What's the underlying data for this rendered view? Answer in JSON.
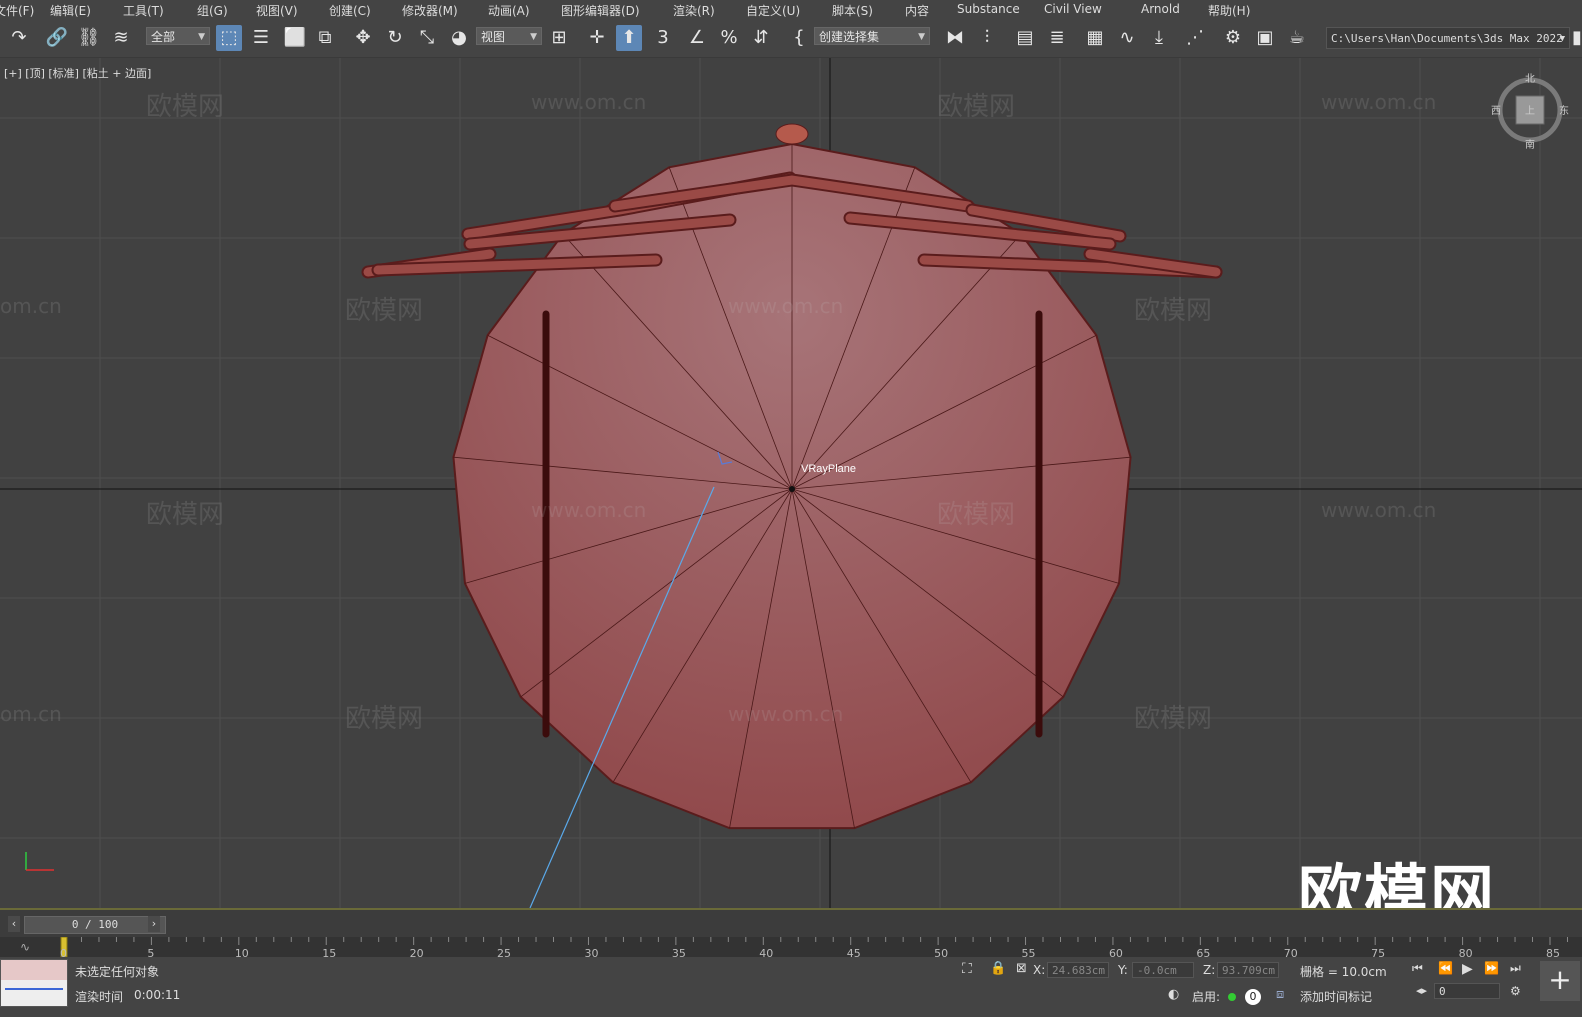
{
  "menu": [
    "文件(F)",
    "编辑(E)",
    "工具(T)",
    "组(G)",
    "视图(V)",
    "创建(C)",
    "修改器(M)",
    "动画(A)",
    "图形编辑器(D)",
    "渲染(R)",
    "自定义(U)",
    "脚本(S)",
    "内容",
    "Substance",
    "Civil View",
    "Arnold",
    "帮助(H)"
  ],
  "toolbar": {
    "selection_filter": "全部",
    "ref_coord": "视图",
    "named_selection": "创建选择集",
    "snap_label": "3",
    "project_path": "C:\\Users\\Han\\Documents\\3ds Max 2022"
  },
  "viewport": {
    "label": "[+] [顶] [标准] [粘土 + 边面]",
    "object_label": "VRayPlane",
    "viewcube": {
      "top": "北",
      "bottom": "南",
      "left": "西",
      "right": "东",
      "face": "上"
    },
    "watermark_text": "欧模网",
    "watermark_url": "www.om.cn",
    "watermark_url_partial": "om.cn",
    "big_watermark": "欧模网",
    "object_color": "#a85a5e"
  },
  "timeline": {
    "frame_display": "0 / 100",
    "ticks": [
      "0",
      "5",
      "10",
      "15",
      "20",
      "25",
      "30",
      "35",
      "40",
      "45",
      "50",
      "55",
      "60",
      "65",
      "70",
      "75",
      "80",
      "85"
    ]
  },
  "status": {
    "selection": "未选定任何对象",
    "render_time_label": "渲染时间",
    "render_time_value": "0:00:11",
    "x_label": "X:",
    "x_value": "24.683cm",
    "y_label": "Y:",
    "y_value": "-0.0cm",
    "z_label": "Z:",
    "z_value": "93.709cm",
    "grid": "栅格 = 10.0cm",
    "enable_label": "启用:",
    "enable_count": "0",
    "add_time_tag": "添加时间标记",
    "frame_field": "0"
  }
}
